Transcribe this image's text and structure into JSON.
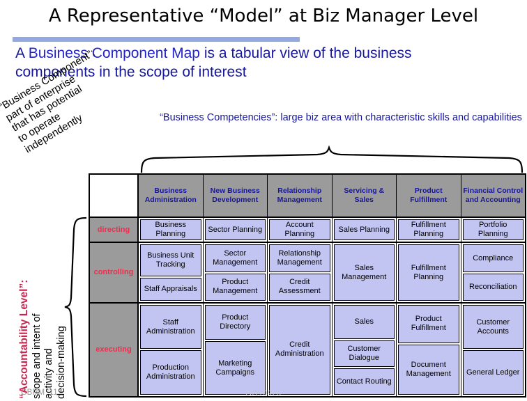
{
  "slide": {
    "title": "A Representative “Model” at Biz Manager Level",
    "subtitle_prefix": "A ",
    "subtitle_highlight": "Business Component Map",
    "subtitle_rest": " is a tabular view of the business components in the scope of interest",
    "footer": "CBPM '11",
    "watermark": "20110925"
  },
  "notes": {
    "business_component": "“Business Component”:\npart of enterprise\nthat has potential\nto operate\nindependently",
    "business_competencies": "“Business Competencies”: large biz area with characteristic skills and capabilities",
    "accountability_label": "“Accountability Level”:",
    "accountability_body": "scope and intent of\nactivity and\ndecision-making"
  },
  "colors": {
    "title_rule": "#93a7e0",
    "header_gray": "#9b9b9b",
    "header_text": "#17179e",
    "cell_fill": "#c2c5f2",
    "row_label": "#ef2d4f",
    "subtitle": "#17179e"
  },
  "chart_data": {
    "type": "table",
    "title": "Business Component Map",
    "columns": [
      "Business Administration",
      "New Business Development",
      "Relationship Management",
      "Servicing & Sales",
      "Product Fulfillment",
      "Financial Control and Accounting"
    ],
    "rows": [
      "directing",
      "controlling",
      "executing"
    ],
    "cells": [
      [
        [
          "Business Planning"
        ],
        [
          "Sector Planning"
        ],
        [
          "Account Planning"
        ],
        [
          "Sales Planning"
        ],
        [
          "Fulfillment Planning"
        ],
        [
          "Portfolio Planning"
        ]
      ],
      [
        [
          "Business Unit Tracking",
          "Staff Appraisals"
        ],
        [
          "Sector Management",
          "Product Management"
        ],
        [
          "Relationship Management",
          "Credit Assessment"
        ],
        [
          "Sales Management"
        ],
        [
          "Fulfillment Planning"
        ],
        [
          "Compliance",
          "Reconciliation"
        ]
      ],
      [
        [
          "Staff Administration",
          "Production Administration"
        ],
        [
          "Product Directory",
          "Marketing Campaigns"
        ],
        [
          "Credit Administration"
        ],
        [
          "Sales",
          "Customer Dialogue",
          "Contact Routing"
        ],
        [
          "Product Fulfillment",
          "Document Management"
        ],
        [
          "Customer Accounts",
          "General Ledger"
        ]
      ]
    ]
  }
}
